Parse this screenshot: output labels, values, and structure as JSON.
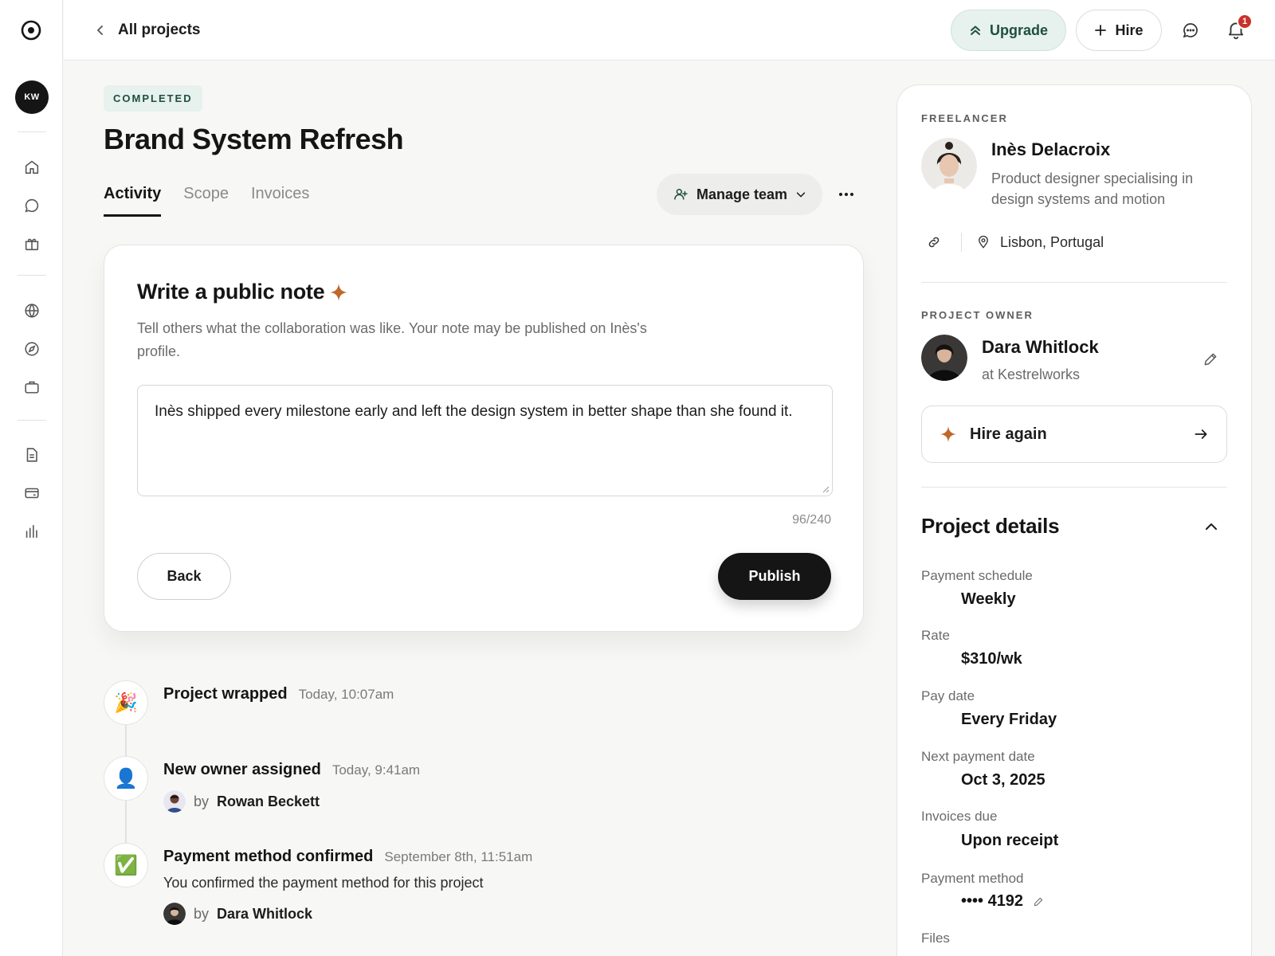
{
  "sidebar": {
    "avatar_initials": "KW",
    "icons": [
      "home-icon",
      "chat-icon",
      "gift-icon",
      "globe-icon",
      "compass-icon",
      "briefcase-icon",
      "document-icon",
      "card-icon",
      "bar-chart-icon"
    ]
  },
  "topbar": {
    "back_label": "All projects",
    "upgrade_label": "Upgrade",
    "hire_label": "Hire",
    "notification_count": "1"
  },
  "project": {
    "status": "COMPLETED",
    "title": "Brand System Refresh",
    "tabs": [
      {
        "label": "Activity",
        "active": true
      },
      {
        "label": "Scope",
        "active": false
      },
      {
        "label": "Invoices",
        "active": false
      }
    ],
    "manage_team_label": "Manage team"
  },
  "note": {
    "title": "Write a public note",
    "description": "Tell others what the collaboration was like. Your note may be published on Inès's profile.",
    "text": "Inès shipped every milestone early and left the design system in better shape than she found it.",
    "char_count": "96/240",
    "back_label": "Back",
    "publish_label": "Publish"
  },
  "activity": [
    {
      "emoji": "🎉",
      "title": "Project wrapped",
      "time": "Today, 10:07am"
    },
    {
      "emoji": "👤",
      "title": "New owner assigned",
      "time": "Today, 9:41am",
      "by_prefix": "by",
      "by_name": "Rowan Beckett"
    },
    {
      "emoji": "✅",
      "title": "Payment method confirmed",
      "time": "September 8th, 11:51am",
      "body": "You confirmed the payment method for this project",
      "by_prefix": "by",
      "by_name": "Dara Whitlock"
    }
  ],
  "freelancer": {
    "label": "FREELANCER",
    "name": "Inès Delacroix",
    "bio": "Product designer specialising in design systems and motion",
    "location": "Lisbon, Portugal"
  },
  "owner": {
    "label": "PROJECT OWNER",
    "name": "Dara Whitlock",
    "company": "at Kestrelworks"
  },
  "hire_again_label": "Hire again",
  "details": {
    "title": "Project details",
    "rows": [
      {
        "label": "Payment schedule",
        "value": "Weekly"
      },
      {
        "label": "Rate",
        "value": "$310/wk"
      },
      {
        "label": "Pay date",
        "value": "Every Friday"
      },
      {
        "label": "Next payment date",
        "value": "Oct 3, 2025"
      },
      {
        "label": "Invoices due",
        "value": "Upon receipt"
      },
      {
        "label": "Payment method",
        "value": "•••• 4192"
      },
      {
        "label": "Files",
        "value": ""
      }
    ]
  },
  "colors": {
    "accent_green": "#1e4f40",
    "accent_green_bg": "#e7f1ee",
    "sparkle": "#c0672a",
    "badge_red": "#c8322a"
  }
}
